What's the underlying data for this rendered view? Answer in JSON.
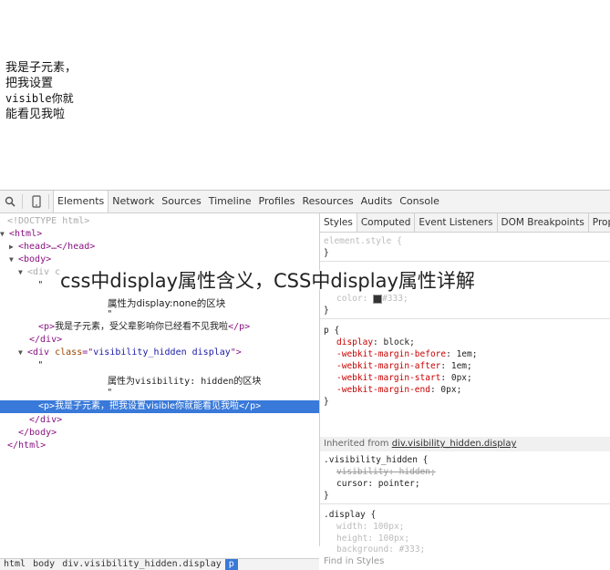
{
  "page": {
    "lines": [
      "我是子元素，",
      "把我设置",
      "visible你就",
      "能看见我啦"
    ]
  },
  "toolbar": {
    "tabs": [
      "Elements",
      "Network",
      "Sources",
      "Timeline",
      "Profiles",
      "Resources",
      "Audits",
      "Console"
    ]
  },
  "elements": {
    "doctype": "<!DOCTYPE html>",
    "html_open": "<html>",
    "head": "<head>…</head>",
    "body_open": "<body>",
    "div1_open": "<div c",
    "quote": "\"",
    "text_none": "属性为display:none的区块",
    "p1": "我是子元素，受父辈影响你已经看不见我啦",
    "div_close": "</div>",
    "div2_class": "visibility_hidden display",
    "text_hidden_a": "属性为",
    "text_hidden_b": "visibility: hidden",
    "text_hidden_c": "的区块",
    "p2": "我是子元素，把我设置visible你就能看见我啦",
    "body_close": "</body>",
    "html_close": "</html>"
  },
  "breadcrumbs": [
    "html",
    "body",
    "div.visibility_hidden.display",
    "p"
  ],
  "styles": {
    "tabs": [
      "Styles",
      "Computed",
      "Event Listeners",
      "DOM Breakpoints",
      "Prop"
    ],
    "element_style": "element.style {",
    "close": "}",
    "color_prop": "color",
    "color_val": "#333",
    "p_selector": "p {",
    "p_rules": [
      {
        "prop": "display",
        "val": "block;"
      },
      {
        "prop": "-webkit-margin-before",
        "val": "1em;"
      },
      {
        "prop": "-webkit-margin-after",
        "val": "1em;"
      },
      {
        "prop": "-webkit-margin-start",
        "val": "0px;"
      },
      {
        "prop": "-webkit-margin-end",
        "val": "0px;"
      }
    ],
    "inherited_label": "Inherited from",
    "inherited_from": "div.visibility_hidden.display",
    "vh_selector": ".visibility_hidden {",
    "vh_rules": [
      {
        "prop": "visibility",
        "val": "hidden;"
      },
      {
        "prop": "cursor",
        "val": "pointer;"
      }
    ],
    "display_selector": ".display {",
    "display_rules": [
      {
        "prop": "width",
        "val": "100px;"
      },
      {
        "prop": "height",
        "val": "100px;"
      },
      {
        "prop": "background",
        "val": "#333;"
      }
    ],
    "find": "Find in Styles"
  },
  "overlay": {
    "title": "css中display属性含义，CSS中display属性详解"
  },
  "colors": {
    "selection": "#3879d9",
    "tag": "#881280",
    "property": "#c80000"
  }
}
